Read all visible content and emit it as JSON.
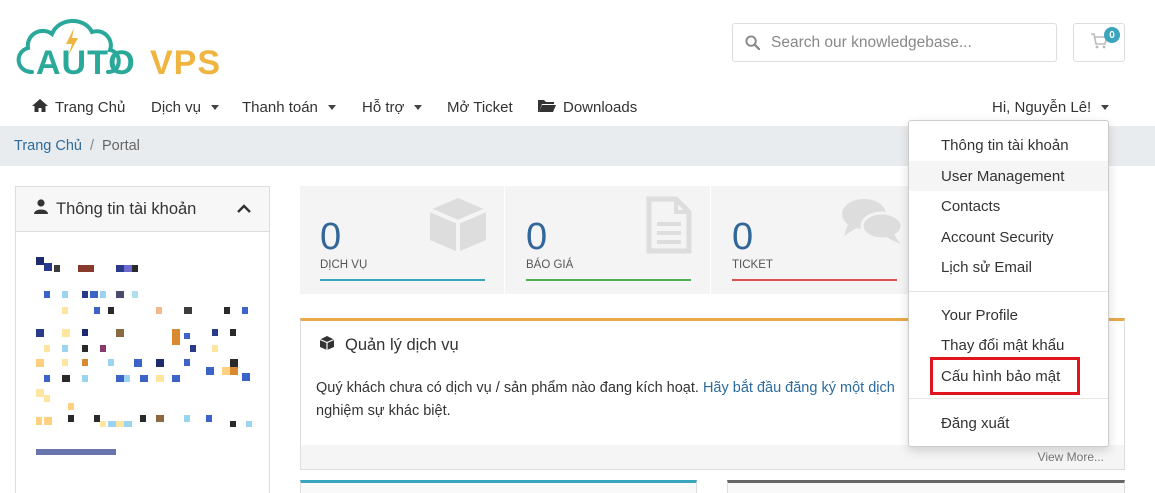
{
  "brand": {
    "logo_text_auto": "AUTO",
    "logo_text_vps": "VPS",
    "primary_color": "#2aa89a",
    "accent_color": "#f0b440"
  },
  "search": {
    "placeholder": "Search our knowledgebase..."
  },
  "cart": {
    "count": "0",
    "icon": "cart-icon"
  },
  "nav": {
    "home": "Trang Chủ",
    "services": "Dịch vụ",
    "billing": "Thanh toán",
    "support": "Hỗ trợ",
    "open_ticket": "Mở Ticket",
    "downloads": "Downloads",
    "user_greeting": "Hi, Nguyễn Lê!"
  },
  "breadcrumb": {
    "home": "Trang Chủ",
    "separator": "/",
    "current": "Portal"
  },
  "sidebar": {
    "title": "Thông tin tài khoản"
  },
  "stats": [
    {
      "value": "0",
      "label": "DỊCH VỤ",
      "color": "#3aa5bd",
      "icon": "cube-icon"
    },
    {
      "value": "0",
      "label": "BÁO GIÁ",
      "color": "#4caf50",
      "icon": "document-icon"
    },
    {
      "value": "0",
      "label": "TICKET",
      "color": "#d9534f",
      "icon": "comments-icon"
    }
  ],
  "services_panel": {
    "title": "Quản lý dịch vụ",
    "text_before": "Quý khách chưa có dịch vụ / sản phẩm nào đang kích hoạt. ",
    "link_text": "Hãy bắt đầu đăng ký một dịch",
    "text_after": "nghiệm sự khác biệt.",
    "view_more": "View More..."
  },
  "user_menu": {
    "items": [
      "Thông tin tài khoản",
      "User Management",
      "Contacts",
      "Account Security",
      "Lịch sử Email",
      "Your Profile",
      "Thay đổi mật khẩu",
      "Cấu hình bảo mật",
      "Đăng xuất"
    ],
    "highlighted": "Cấu hình bảo mật",
    "highlight_color": "#e0161e"
  }
}
